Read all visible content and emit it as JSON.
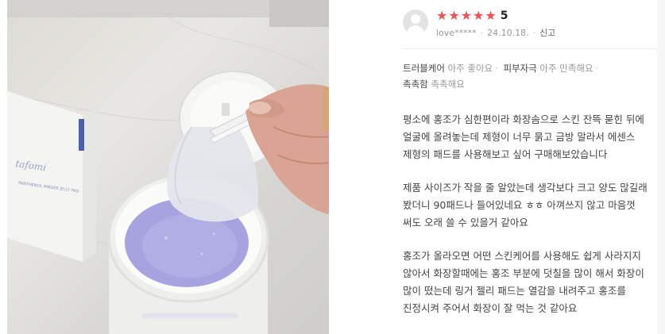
{
  "review": {
    "rating_label": "5",
    "stars": [
      "★",
      "★",
      "★",
      "★",
      "★"
    ],
    "user": "love*****",
    "date": "24.10.18.",
    "report": "신고",
    "tags": [
      {
        "key": "트러블케어",
        "value": "아주 좋아요"
      },
      {
        "key": "피부자극",
        "value": "아주 만족해요"
      },
      {
        "key": "촉촉함",
        "value": "촉촉해요"
      }
    ],
    "paragraphs": [
      "평소에 홍조가 심한편이라 화장솜으로 스킨 잔뜩 묻힌 뒤에 얼굴에 올려놓는데 제형이 너무 묽고 금방 말라서 에센스 제형의 패드를 사용해보고 싶어 구매해보았습니다",
      "제품 사이즈가 작을 줄 알았는데 생각보다 크고 양도 많길래 봤더니 90패드나 들어있네요 ㅎㅎ 아껴쓰지 않고 마음껏 써도 오래 쓸 수 있을거 같아요",
      "홍조가 올라오면 어떤 스킨케어를 사용해도 쉽게 사라지지 않아서 화장할때에는 홍조 부분에 덧칠을 많이 해서 화장이 많이 떴는데 링거 젤리 패드는 열감을 내려주고 홍조를 진정시켜 주어서 화장이 잘 먹는 것 같아요"
    ]
  },
  "photo": {
    "brand_text": "tafomi",
    "product_text": "PANTHENOL RINGER JELLY PAD",
    "colors": {
      "jelly": "#a7a3e0",
      "accent": "#f25151"
    }
  }
}
